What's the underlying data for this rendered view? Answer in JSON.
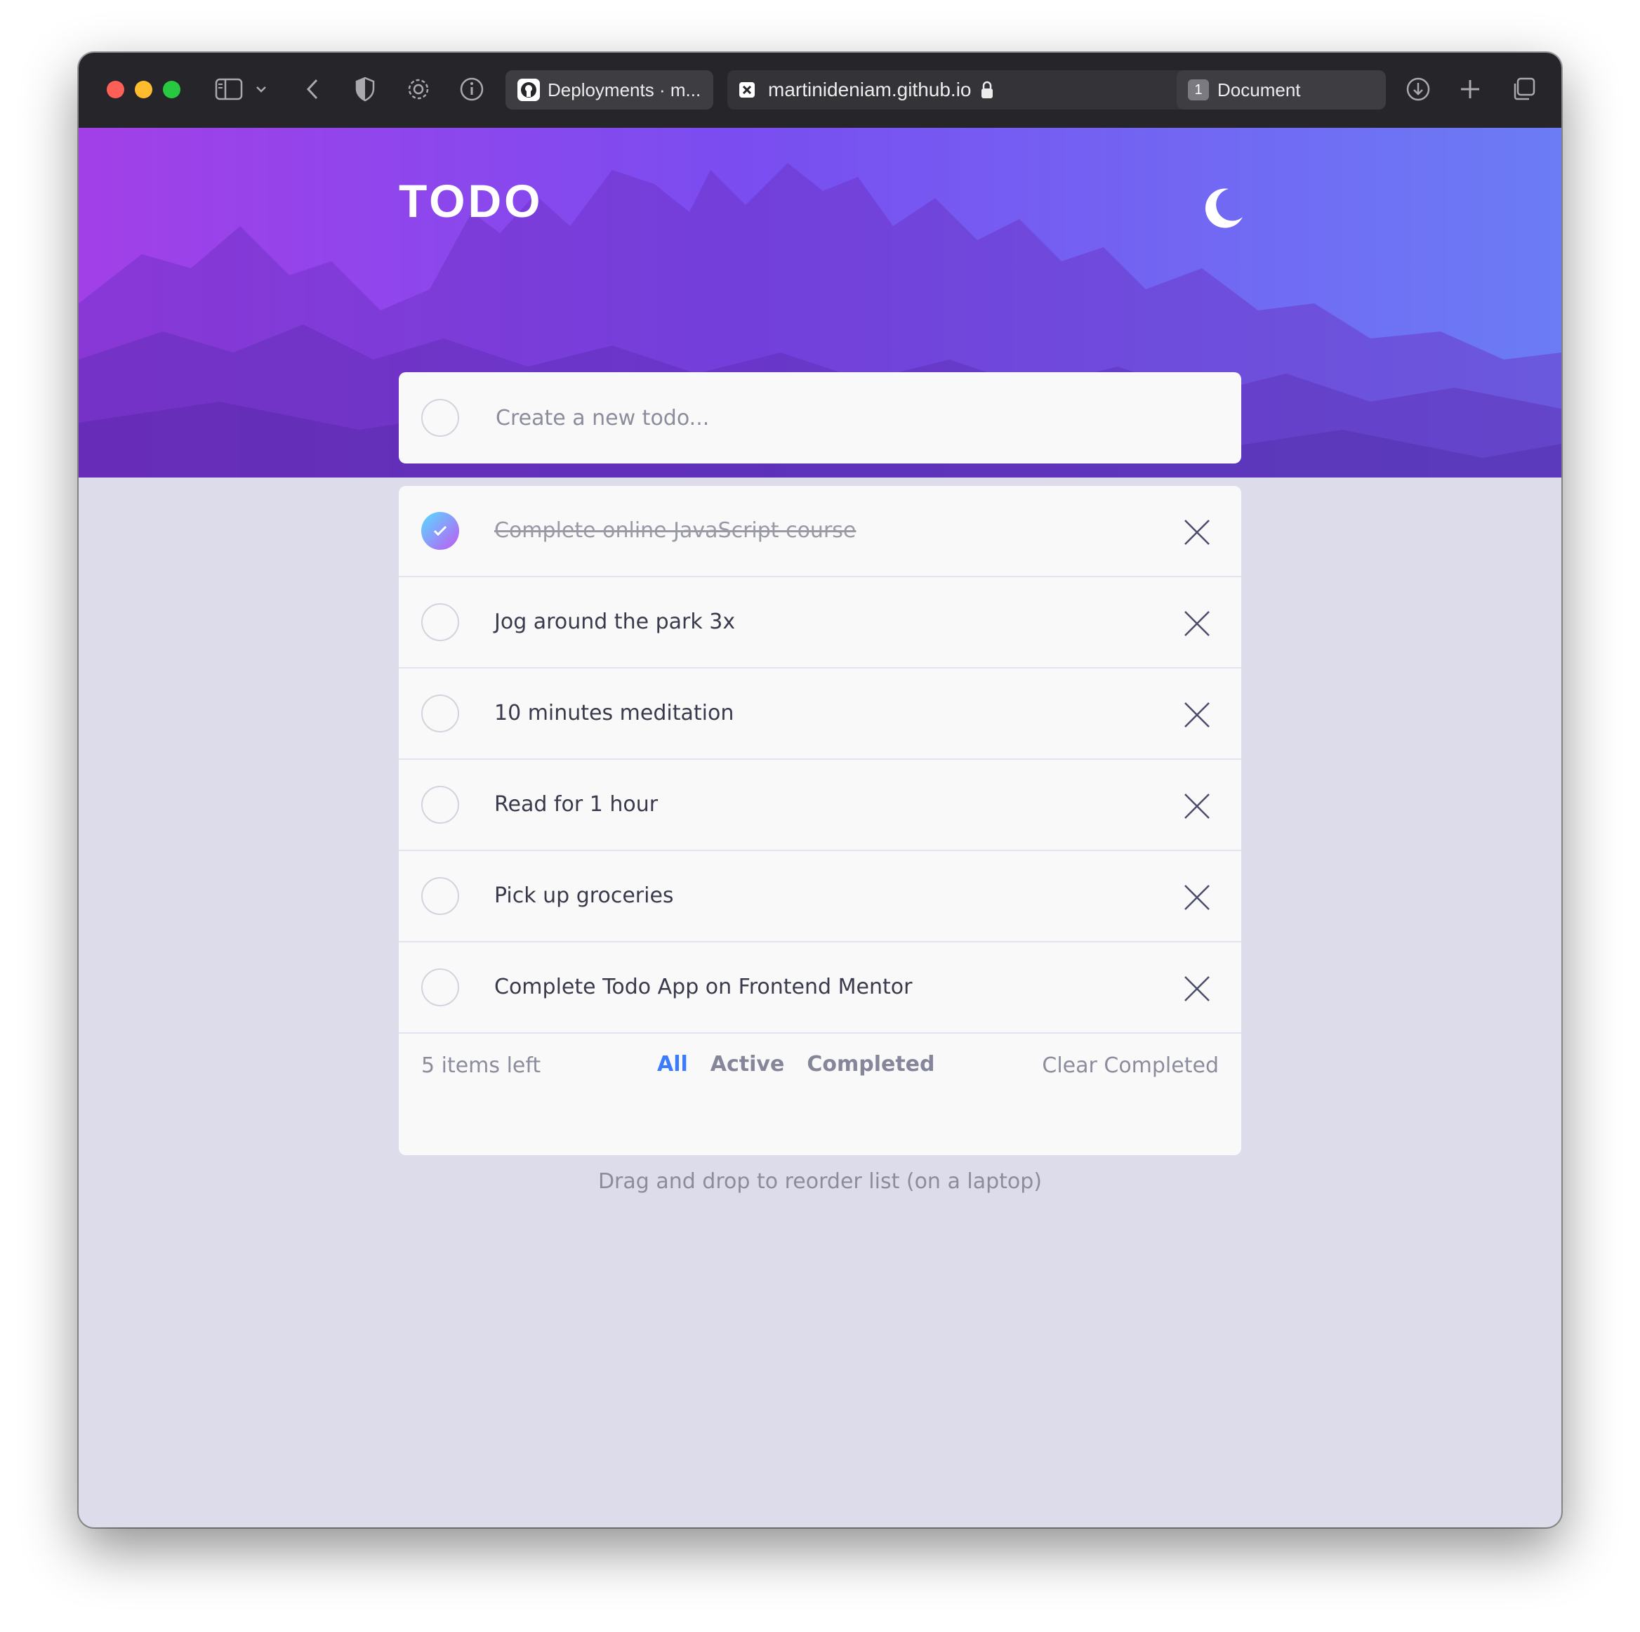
{
  "browser": {
    "tabs": [
      {
        "label": "Deployments · m...",
        "icon": "github-icon"
      },
      {
        "label": "martinideniam.github.io",
        "icon": "site-favicon-icon"
      },
      {
        "label": "Document",
        "badge": "1"
      }
    ]
  },
  "app": {
    "title": "TODO",
    "theme_toggle_icon": "moon-icon",
    "new_todo": {
      "placeholder": "Create a new todo...",
      "value": ""
    },
    "todos": [
      {
        "text": "Complete online JavaScript course",
        "completed": true
      },
      {
        "text": "Jog around the park 3x",
        "completed": false
      },
      {
        "text": "10 minutes meditation",
        "completed": false
      },
      {
        "text": "Read for 1 hour",
        "completed": false
      },
      {
        "text": "Pick up groceries",
        "completed": false
      },
      {
        "text": "Complete Todo App on Frontend Mentor",
        "completed": false
      }
    ],
    "footer": {
      "items_left": "5 items left",
      "filters": [
        "All",
        "Active",
        "Completed"
      ],
      "active_filter": "All",
      "clear": "Clear Completed"
    },
    "hint": "Drag and drop to reorder list (on a laptop)"
  },
  "colors": {
    "accent": "#3a7cfd",
    "check_gradient_start": "#55ddff",
    "check_gradient_end": "#c058f3",
    "page_background": "#dcdceb",
    "card": "#f9f9fa"
  }
}
